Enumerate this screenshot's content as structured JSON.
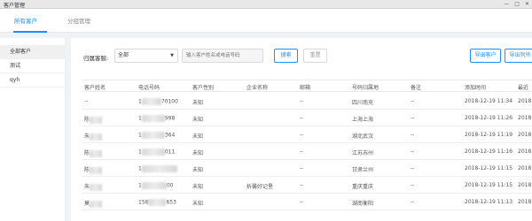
{
  "window": {
    "title": "客户管理",
    "controls": [
      "—",
      "□",
      "✕"
    ]
  },
  "tabs": [
    {
      "label": "所有客户",
      "active": true
    },
    {
      "label": "分组管理",
      "active": false
    }
  ],
  "sidebar": {
    "items": [
      "全部客户",
      "测试",
      "qyh"
    ]
  },
  "filter": {
    "label": "归属客服:",
    "select_value": "全部",
    "search_placeholder": "输入客户姓名或电话号码",
    "search_button": "搜索",
    "reset_button": "重置",
    "export_button": "导出客户",
    "export_list_button": "导出列外"
  },
  "table": {
    "headers": [
      "客户姓名",
      "电话号码",
      "客户性别",
      "企业名称",
      "邮箱",
      "号码归属地",
      "备注",
      "添加时间",
      "最近"
    ],
    "rows": [
      [
        "--",
        "1",
        "70100",
        "未知",
        "--",
        "--",
        "四川南充",
        "--",
        "2018-12-19 11:34",
        "2018"
      ],
      [
        "陈",
        "1",
        "998",
        "未知",
        "--",
        "--",
        "上海上海",
        "--",
        "2018-12-19 11:26",
        "2018"
      ],
      [
        "朱",
        "1",
        "364",
        "未知",
        "--",
        "--",
        "湖北武汉",
        "--",
        "2018-12-19 11:19",
        "2018"
      ],
      [
        "陈",
        "1",
        "011",
        "未知",
        "--",
        "--",
        "江苏苏州",
        "--",
        "2018-12-19 11:16",
        "2018"
      ],
      [
        "陈",
        "1",
        "",
        "未知",
        "--",
        "--",
        "甘肃兰州",
        "--",
        "2018-12-19 11:15",
        "2018"
      ],
      [
        "朱",
        "1",
        "00",
        "未知",
        "析馨好记垦",
        "--",
        "重庆重庆",
        "--",
        "2018-12-19 11:15",
        "2018"
      ],
      [
        "莫",
        "158",
        "653",
        "未知",
        "--",
        "--",
        "湖南衡阳",
        "--",
        "2018-12-19 11:13",
        "2018"
      ]
    ]
  }
}
